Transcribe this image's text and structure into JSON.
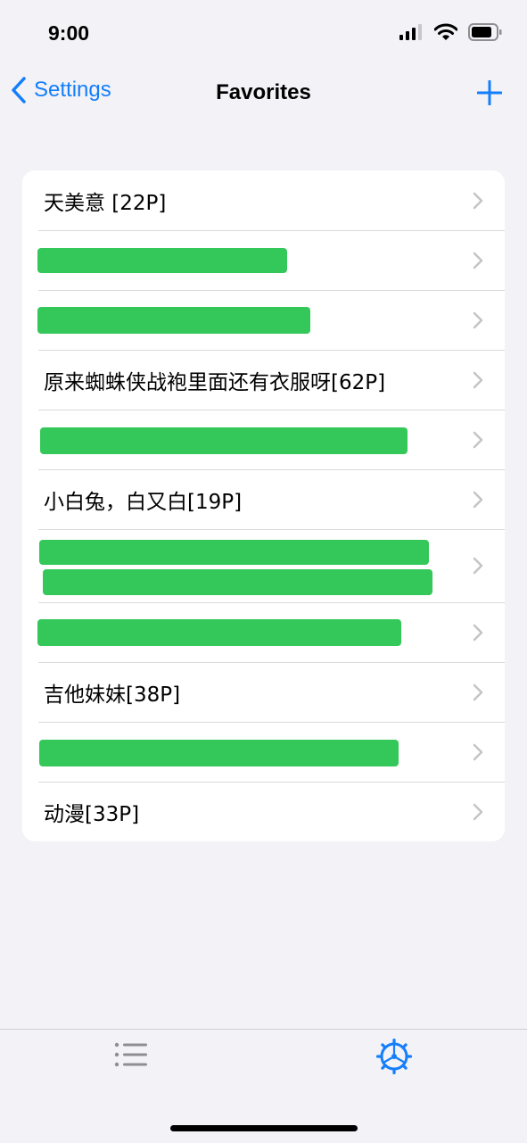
{
  "status_bar": {
    "time": "9:00"
  },
  "nav": {
    "back_label": "Settings",
    "title": "Favorites"
  },
  "list": {
    "rows": [
      {
        "label": "天美意 [22P]"
      },
      {
        "label": ""
      },
      {
        "label": ""
      },
      {
        "label": "原来蜘蛛侠战袍里面还有衣服呀[62P]"
      },
      {
        "label": ""
      },
      {
        "label": "小白兔，白又白[19P]"
      },
      {
        "label": ""
      },
      {
        "label": ""
      },
      {
        "label": "吉他妹妹[38P]"
      },
      {
        "label": ""
      },
      {
        "label": "动漫[33P]"
      }
    ]
  },
  "tabbar": {
    "tabs": [
      {
        "icon": "list-icon"
      },
      {
        "icon": "gear-icon"
      }
    ]
  },
  "colors": {
    "accent": "#147efb",
    "background": "#f2f2f7",
    "redaction": "#34c759"
  }
}
